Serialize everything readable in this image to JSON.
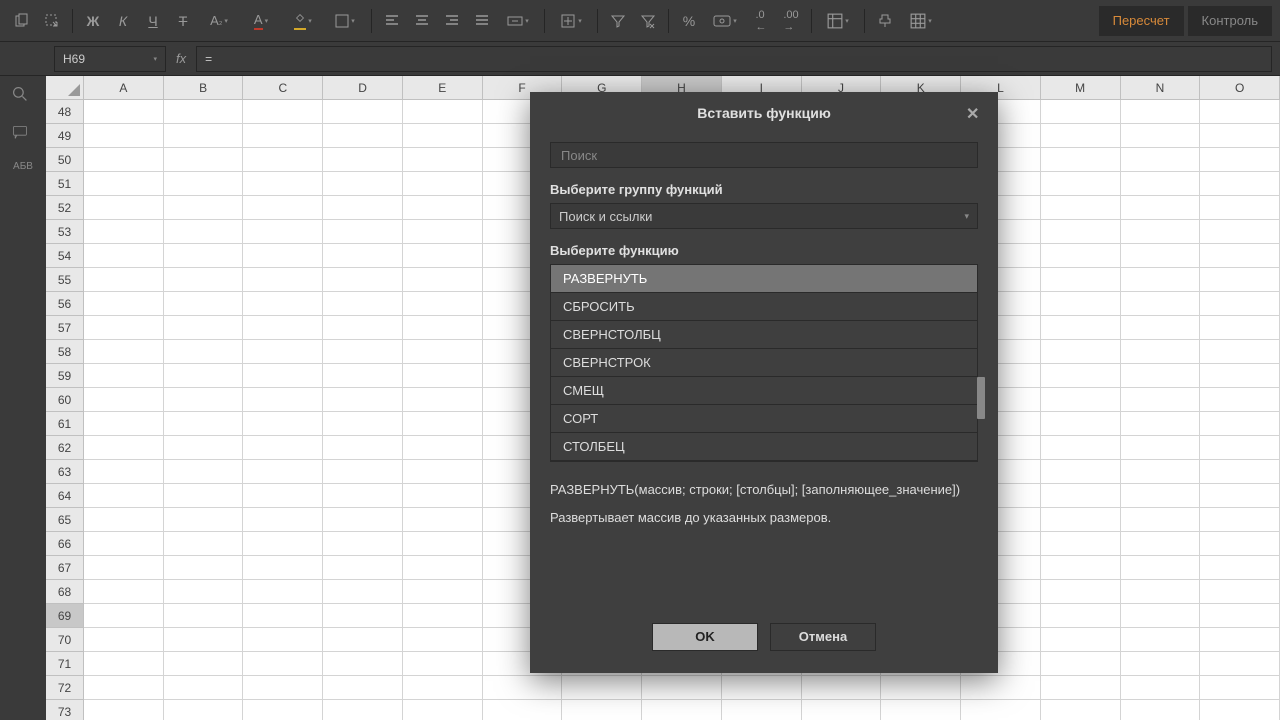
{
  "toolbar": {
    "bold": "Ж",
    "italic": "К",
    "underline": "Ч",
    "strike": "Т",
    "fontcolor_sub": "₂",
    "percent": "%",
    "recalc": "Пересчет",
    "control": "Контроль"
  },
  "formula": {
    "cell_ref": "H69",
    "fx": "fx",
    "value": "="
  },
  "sidebar_text": "АБВ",
  "columns": [
    "A",
    "B",
    "C",
    "D",
    "E",
    "F",
    "G",
    "H",
    "I",
    "J",
    "K",
    "L",
    "M",
    "N",
    "O"
  ],
  "active_col_index": 7,
  "rows_start": 48,
  "rows_count": 26,
  "active_row": 69,
  "dialog": {
    "title": "Вставить функцию",
    "search_placeholder": "Поиск",
    "group_label": "Выберите группу функций",
    "group_value": "Поиск и ссылки",
    "func_label": "Выберите функцию",
    "functions": [
      "РАЗВЕРНУТЬ",
      "СБРОСИТЬ",
      "СВЕРНСТОЛБЦ",
      "СВЕРНСТРОК",
      "СМЕЩ",
      "СОРТ",
      "СТОЛБЕЦ"
    ],
    "selected_index": 0,
    "signature": "РАЗВЕРНУТЬ(массив; строки; [столбцы]; [заполняющее_значение])",
    "description": "Развертывает массив до указанных размеров.",
    "ok": "OK",
    "cancel": "Отмена"
  }
}
